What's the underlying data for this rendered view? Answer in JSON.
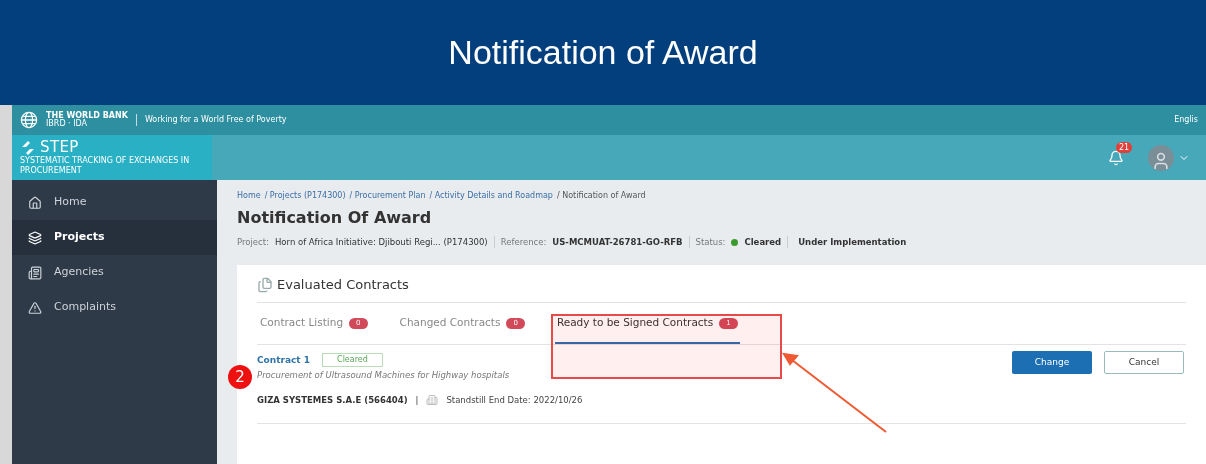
{
  "slide_title": "Notification of Award",
  "top_bar": {
    "org_name": "THE WORLD BANK",
    "org_sub": "IBRD · IDA",
    "tagline": "Working for a World Free of Poverty",
    "language": "Englis"
  },
  "app_header": {
    "logo": "STEP",
    "logo_sub": "SYSTEMATIC TRACKING OF EXCHANGES IN PROCUREMENT",
    "notification_count": "21"
  },
  "sidebar": {
    "items": [
      {
        "label": "Home",
        "selected": false
      },
      {
        "label": "Projects",
        "selected": true
      },
      {
        "label": "Agencies",
        "selected": false
      },
      {
        "label": "Complaints",
        "selected": false
      }
    ]
  },
  "breadcrumb": [
    {
      "label": "Home"
    },
    {
      "label": "/ Projects (P174300)"
    },
    {
      "label": "/ Procurement Plan"
    },
    {
      "label": "/ Activity Details and Roadmap"
    },
    {
      "label": "/ Notification of Award"
    }
  ],
  "page_title": "Notification Of Award",
  "meta": {
    "project_label": "Project:",
    "project": "Horn of Africa Initiative: Djibouti Regi...  (P174300)",
    "reference_label": "Reference:",
    "reference": "US-MCMUAT-26781-GO-RFB",
    "status_label": "Status:",
    "status": "Cleared",
    "phase": "Under Implementation"
  },
  "card": {
    "title": "Evaluated Contracts",
    "tabs": [
      {
        "label": "Contract Listing",
        "count": "0",
        "selected": false
      },
      {
        "label": "Changed Contracts",
        "count": "0",
        "selected": false
      },
      {
        "label": "Ready to be Signed Contracts",
        "count": "1",
        "selected": true
      }
    ],
    "contract": {
      "name": "Contract 1",
      "status": "Cleared",
      "description": "Procurement of Ultrasound Machines for Highway hospitals",
      "supplier": "GIZA SYSTEMES S.A.E (566404)",
      "separator": "|",
      "standstill": "Standstill End Date: 2022/10/26"
    },
    "buttons": [
      {
        "label": "Change",
        "kind": "primary"
      },
      {
        "label": "Cancel",
        "kind": "secondary"
      }
    ]
  },
  "annotation": {
    "step": "2"
  }
}
